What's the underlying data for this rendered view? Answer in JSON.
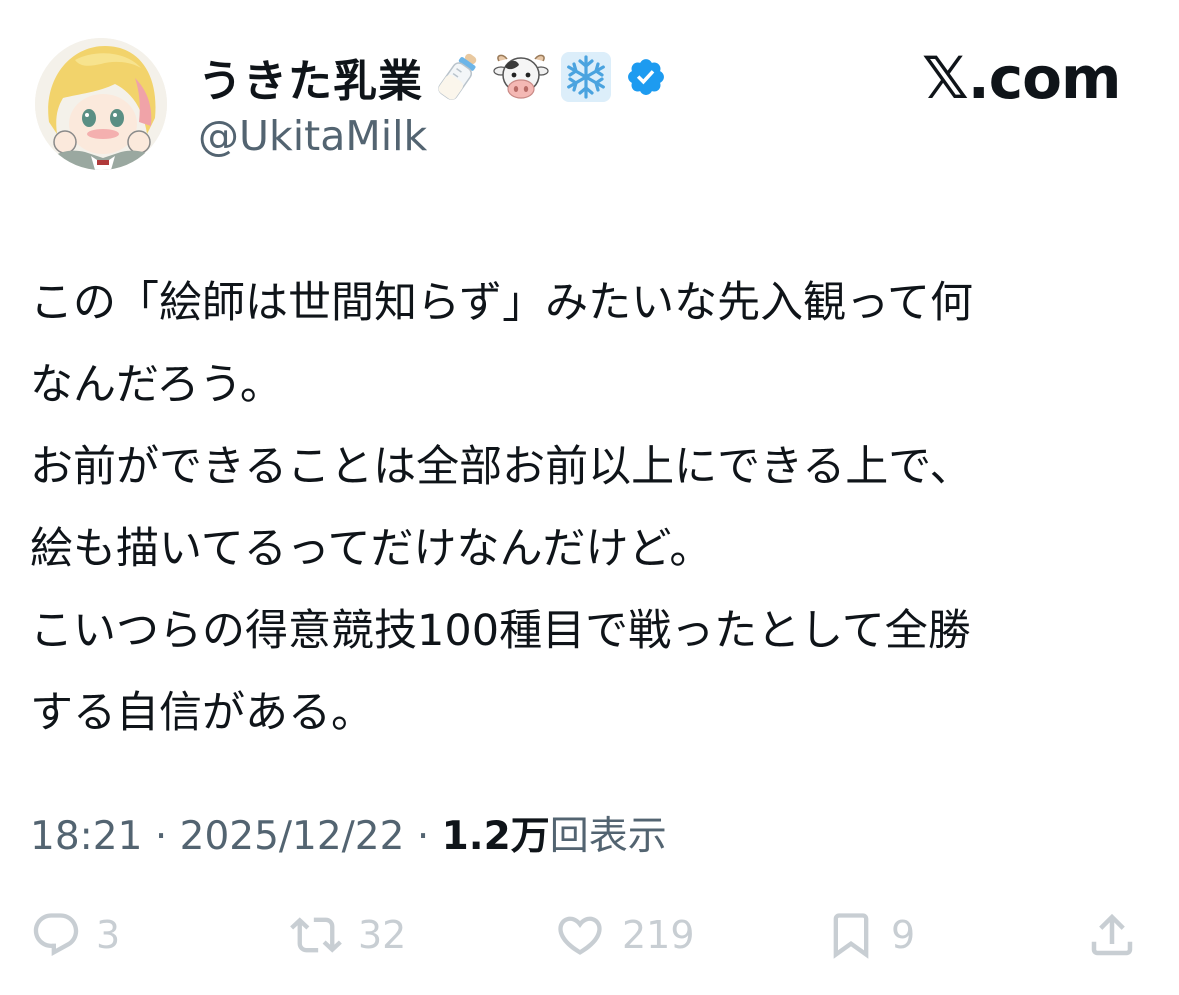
{
  "user": {
    "display_name": "うきた乳業",
    "handle": "@UkitaMilk",
    "name_emojis": [
      "baby-bottle-icon",
      "cow-face-icon",
      "snowflake-icon"
    ],
    "verified": true,
    "verified_color": "#1d9bf0"
  },
  "watermark": "𝕏.com",
  "tweet": {
    "lines": [
      "この「絵師は世間知らず」みたいな先入観って何",
      "なんだろう。",
      "お前ができることは全部お前以上にできる上で、",
      "絵も描いてるってだけなんだけど。",
      "こいつらの得意競技100種目で戦ったとして全勝",
      "する自信がある。"
    ]
  },
  "meta": {
    "time": "18:21",
    "date": "2025/12/22",
    "separator": "·",
    "views_count": "1.2万",
    "views_label": "回表示"
  },
  "actions": {
    "replies": "3",
    "reposts": "32",
    "likes": "219",
    "bookmarks": "9"
  },
  "colors": {
    "text": "#0f1419",
    "secondary": "#536471",
    "faded": "#c8ced3"
  }
}
